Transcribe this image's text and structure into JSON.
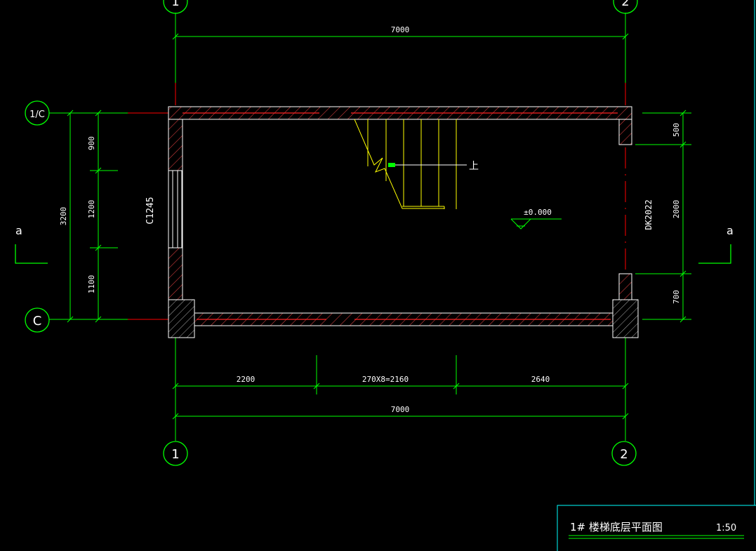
{
  "colors": {
    "background": "#000000",
    "dimension": "#00ff00",
    "axis_line": "#ff0000",
    "wall": "#ffffff",
    "hatch": "#ff3333",
    "stair": "#ffff00",
    "title_frame": "#00ffff",
    "text": "#ffffff"
  },
  "axes": {
    "col_1": "1",
    "col_2": "2",
    "row_1c": "1/C",
    "row_c": "C"
  },
  "dimensions": {
    "top_total": "7000",
    "bottom_seg_1": "2200",
    "bottom_seg_2": "270X8=2160",
    "bottom_seg_3": "2640",
    "bottom_total": "7000",
    "left_total": "3200",
    "left_seg_1": "900",
    "left_seg_2": "1200",
    "left_seg_3": "1100",
    "right_seg_1": "500",
    "right_seg_2": "2000",
    "right_seg_3": "700"
  },
  "labels": {
    "window": "C1245",
    "door": "DK2022",
    "elevation": "±0.000",
    "stair_up": "上",
    "section_left": "a",
    "section_right": "a"
  },
  "title_block": {
    "title": "1# 楼梯底层平面图",
    "scale": "1:50"
  }
}
